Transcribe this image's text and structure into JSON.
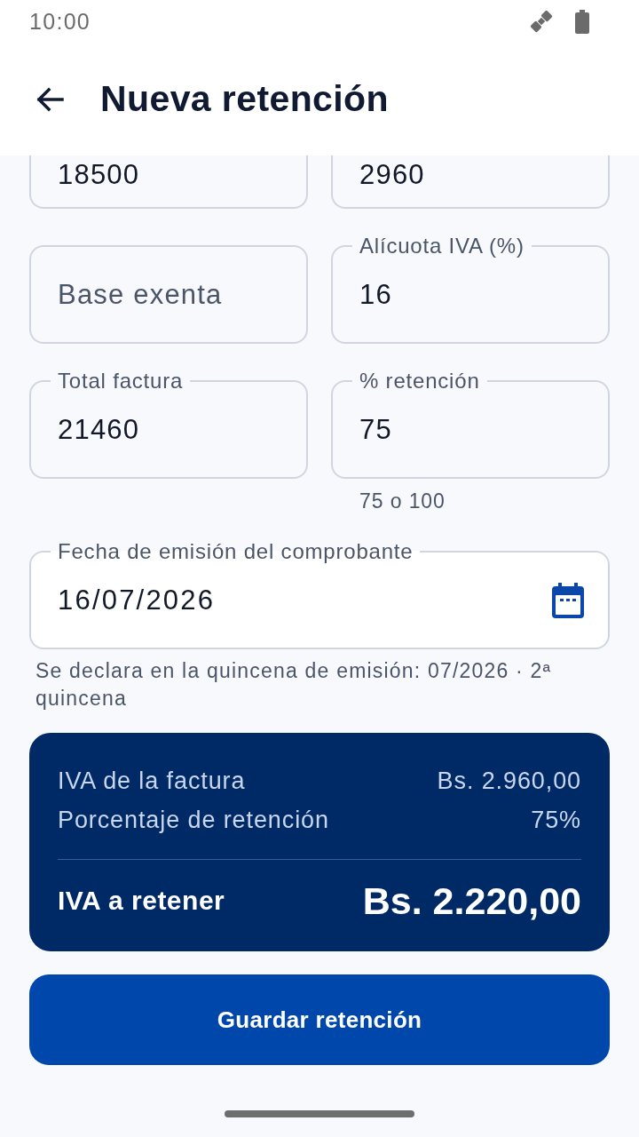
{
  "status_bar": {
    "time": "10:00"
  },
  "app_bar": {
    "title": "Nueva retención"
  },
  "form_rows": [
    {
      "fields": [
        {
          "value": "18500"
        },
        {
          "value": "2960"
        }
      ]
    },
    {
      "fields": [
        {
          "placeholder": "Base exenta"
        },
        {
          "label": "Alícuota IVA (%)",
          "value": "16"
        }
      ]
    },
    {
      "fields": [
        {
          "label": "Total factura",
          "value": "21460"
        },
        {
          "label": "% retención",
          "value": "75",
          "helper": "75 o 100"
        }
      ]
    }
  ],
  "date_field": {
    "label": "Fecha de emisión del comprobante",
    "value": "16/07/2026",
    "helper": "Se declara en la quincena de emisión: 07/2026 · 2ª quincena"
  },
  "summary": {
    "rows": [
      {
        "label": "IVA de la factura",
        "value": "Bs. 2.960,00"
      },
      {
        "label": "Porcentaje de retención",
        "value": "75%"
      }
    ],
    "total": {
      "label": "IVA a retener",
      "value": "Bs. 2.220,00"
    }
  },
  "save_button": {
    "label": "Guardar retención"
  }
}
